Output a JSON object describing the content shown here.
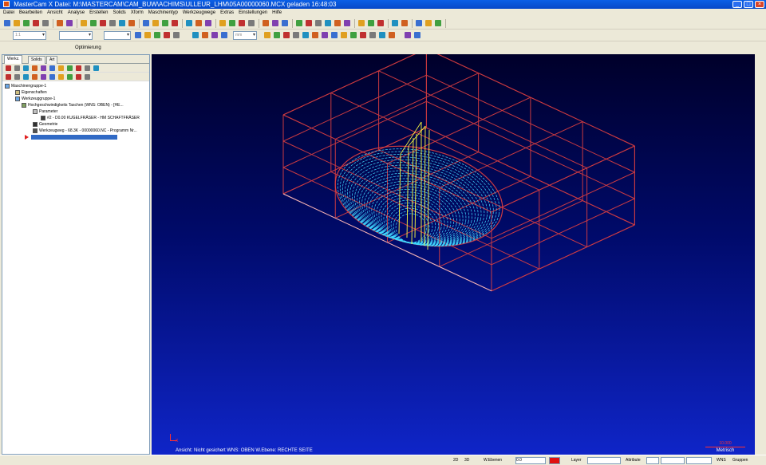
{
  "window": {
    "title": "MasterCam X Datei: M:\\MASTERCAM\\CAM_BUW\\ACHIMS\\ULLEUR_LHM\\05A00000060.MCX geladen 16:48:03"
  },
  "menu": {
    "items": [
      "Datei",
      "Bearbeiten",
      "Ansicht",
      "Analyse",
      "Erstellen",
      "Solids",
      "Xform",
      "Maschinentyp",
      "Werkzeugwege",
      "Extras",
      "Einstellungen",
      "Hilfe"
    ]
  },
  "toolbar": {
    "zoom_combo": "1:1",
    "level_combo": "",
    "attr_combo": "",
    "grid_combo": "mm"
  },
  "operation_bar": {
    "label": "Optimierung"
  },
  "left_panel": {
    "tabs": [
      "Werkz.",
      "Solids",
      "Art"
    ],
    "tree": [
      "Maschinengruppe-1",
      "Eigenschaften",
      "Werkzeuggruppe-1",
      "Hochgeschwindigkeits Taschen (WNS: OBEN) - [HE...",
      "Parameter",
      "#2 - D0.00 KUGELFRÄSER - HM SCHAFTFRÄSER",
      "Geometrie",
      "Werkzeugweg - 68.3K - 00000060.NC - Programm Nr..."
    ]
  },
  "viewport": {
    "status_text": "Ansicht: Nicht gesichert  WNS: OBEN  W.Ebene: RECHTE SEITE",
    "scale_value": "10.000",
    "scale_label": "Metrisch",
    "axis_label": "X"
  },
  "colors": {
    "viewport_top": "#00002a",
    "viewport_bottom": "#0f25c8",
    "stock_wire": "#e04040",
    "toolpath_cyan": "#40d8ff",
    "toolpath_yellow": "#ffff40",
    "selection": "#316ac5"
  },
  "statusbar": {
    "z_label": "2D",
    "cplane_label": "3D",
    "value_label": "W.Ebenen",
    "z_value": "0.0",
    "layer_label": "Layer",
    "attr_label": "Attribute",
    "group_label": "WNS",
    "gruppen_label": "Gruppen"
  }
}
